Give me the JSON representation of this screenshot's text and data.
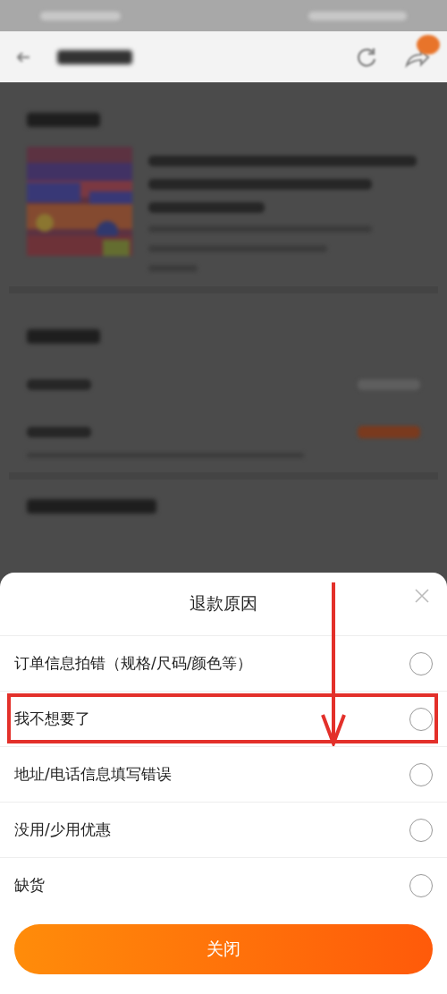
{
  "sheet": {
    "title": "退款原因",
    "options": [
      {
        "label": "订单信息拍错（规格/尺码/颜色等）",
        "selected": false,
        "highlighted": false
      },
      {
        "label": "我不想要了",
        "selected": false,
        "highlighted": true
      },
      {
        "label": "地址/电话信息填写错误",
        "selected": false,
        "highlighted": false
      },
      {
        "label": "没用/少用优惠",
        "selected": false,
        "highlighted": false
      },
      {
        "label": "缺货",
        "selected": false,
        "highlighted": false
      }
    ],
    "button": {
      "label": "关闭"
    }
  }
}
